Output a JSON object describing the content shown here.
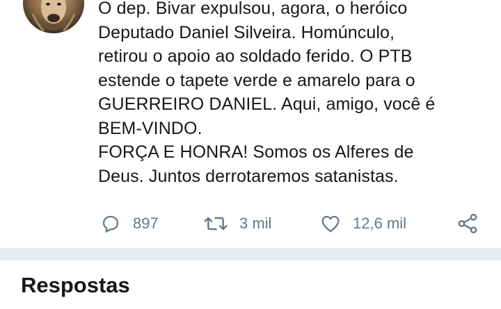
{
  "tweet": {
    "text": "O dep. Bivar expulsou, agora, o heróico\nDeputado Daniel Silveira. Homúnculo,\nretirou o apoio ao soldado ferido. O PTB\nestende o tapete verde e amarelo para o\nGUERREIRO DANIEL. Aqui, amigo, você é\nBEM-VINDO.\nFORÇA E HONRA! Somos os Alferes de\nDeus. Juntos derrotaremos satanistas."
  },
  "actions": {
    "replies": "897",
    "retweets": "3 mil",
    "likes": "12,6 mil"
  },
  "replies_section": {
    "title": "Respostas"
  },
  "colors": {
    "text": "#14171a",
    "secondary": "#657786",
    "separator": "#e6ecf0"
  },
  "icons": [
    "reply-icon",
    "retweet-icon",
    "like-icon",
    "share-icon"
  ]
}
